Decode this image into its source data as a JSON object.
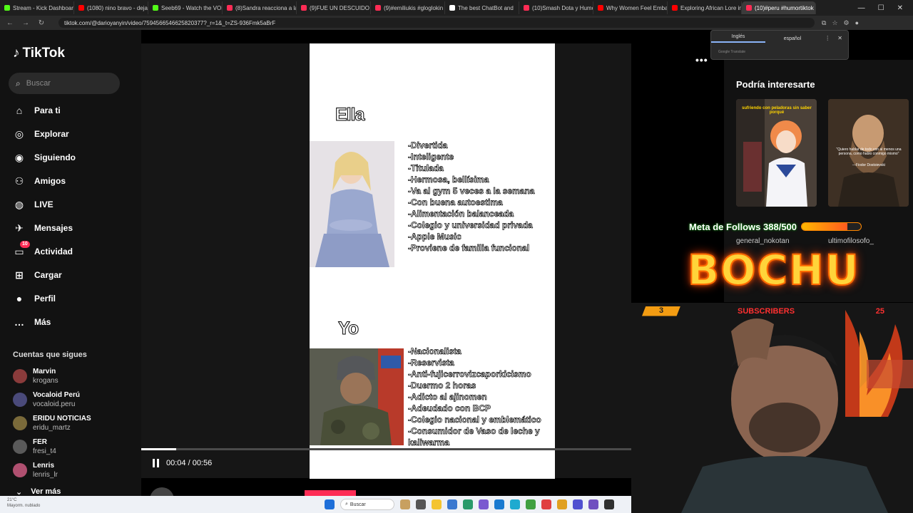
{
  "browser": {
    "tabs": [
      {
        "label": "Stream - Kick Dashboard",
        "color": "#53fc18"
      },
      {
        "label": "(1080) nino bravo - dejar",
        "color": "#ff0000"
      },
      {
        "label": "Seeb69 - Watch the VOD",
        "color": "#53fc18"
      },
      {
        "label": "(8)Sandra reacciona a la",
        "color": "#fe2c55"
      },
      {
        "label": "(9)FUE UN DESCUIDO PO",
        "color": "#fe2c55"
      },
      {
        "label": "(9)#emiliukis #gloglokin",
        "color": "#fe2c55"
      },
      {
        "label": "The best ChatBot and",
        "color": "#ffffff"
      },
      {
        "label": "(10)Smash Dota y Humor",
        "color": "#fe2c55"
      },
      {
        "label": "Why Women Feel Embar",
        "color": "#ff0000"
      },
      {
        "label": "Exploring African Lore in",
        "color": "#ff0000"
      },
      {
        "label": "(10)#peru #humortiktok",
        "color": "#fe2c55"
      }
    ],
    "url": "tiktok.com/@darioyanyin/video/7594566546625820377?_r=1&_t=ZS-936Fmk5aBrF",
    "translate": {
      "lang1": "Inglés",
      "lang2": "español",
      "footer": "Google Translate"
    }
  },
  "sidebar": {
    "logo": "TikTok",
    "search_placeholder": "Buscar",
    "nav": [
      {
        "label": "Para ti",
        "icon": "home-icon"
      },
      {
        "label": "Explorar",
        "icon": "compass-icon"
      },
      {
        "label": "Siguiendo",
        "icon": "following-icon"
      },
      {
        "label": "Amigos",
        "icon": "friends-icon"
      },
      {
        "label": "LIVE",
        "icon": "live-icon"
      },
      {
        "label": "Mensajes",
        "icon": "messages-icon"
      },
      {
        "label": "Actividad",
        "icon": "activity-icon",
        "badge": "10"
      },
      {
        "label": "Cargar",
        "icon": "upload-icon"
      },
      {
        "label": "Perfil",
        "icon": "profile-icon"
      },
      {
        "label": "Más",
        "icon": "more-icon"
      }
    ],
    "following_title": "Cuentas que sigues",
    "following": [
      {
        "name": "Marvin",
        "handle": "krogans",
        "color": "#8a3b3b"
      },
      {
        "name": "Vocaloid Perú",
        "handle": "vocaloid.peru",
        "color": "#4a4a7a"
      },
      {
        "name": "ERIDU NOTICIAS",
        "handle": "eridu_martz",
        "color": "#7a6a3a"
      },
      {
        "name": "FER",
        "handle": "fresi_t4",
        "color": "#5a5a5a"
      },
      {
        "name": "Lenris",
        "handle": "lenris_lr",
        "color": "#b05070"
      }
    ],
    "see_more": "Ver más"
  },
  "video": {
    "ella_title": "Ella",
    "ella_traits": [
      "-Divertida",
      "-Inteligente",
      "-Titulada",
      "-Hermosa, bellísima",
      "-Va al gym 5 veces a la semana",
      "-Con buena autoestima",
      "-Alimentación balanceada",
      "-Colegio y universidad privada",
      "-Apple Music",
      "-Proviene de familia funcional"
    ],
    "yo_title": "Yo",
    "yo_traits": [
      "-Nacionalista",
      "-Reservista",
      "-Anti-fujicerrovizcaporkicismo",
      "-Duermo 2 horas",
      "-Adicto al ajinomen",
      "-Adeudado con BCP",
      "-Colegio nacional y emblemático",
      "-Consumidor de Vaso de leche y",
      "kaliwarma"
    ],
    "time": "00:04 / 00:56",
    "progress": 0.071,
    "creator": "darioyanyin"
  },
  "recommended": {
    "title": "Podría interesarte",
    "card1_user": "general_nokotan",
    "card2_user": "ultimofilosofo_",
    "card1_caption": "sufriendo con peladoras sin saber porqué",
    "card2_quote": "\"Quiero hablar de todo con al menos una persona, como hablo conmigo mismo\"",
    "card2_author": "—Fiodor Dostoievski"
  },
  "stream_overlay": {
    "goal_text": "Meta de Follows 388/500",
    "goal_progress": 0.776,
    "brand": "BOCHU",
    "subs_count": "3",
    "subs_label": "SUBSCRIBERS",
    "subs_goal": "25"
  },
  "taskbar": {
    "weather_temp": "21°C",
    "weather_desc": "Mayorm. nublado",
    "search": "Buscar"
  }
}
